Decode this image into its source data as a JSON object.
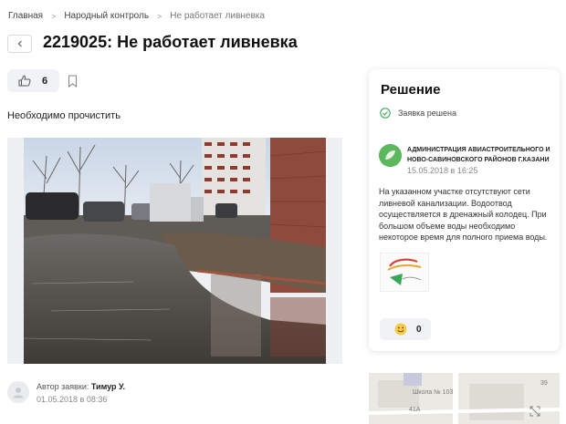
{
  "breadcrumb": [
    "Главная",
    "Народный контроль",
    "Не работает ливневка"
  ],
  "page": {
    "title": "2219025: Не работает ливневка",
    "likes": "6",
    "description": "Необходимо прочистить"
  },
  "author": {
    "label": "Автор заявки:",
    "name": "Тимур У.",
    "date": "01.05.2018 в 08:36"
  },
  "solution": {
    "title": "Решение",
    "status": "Заявка решена",
    "org_name": "АДМИНИСТРАЦИЯ АВИАСТРОИТЕЛЬНОГО И НОВО-САВИНОВСКОГО РАЙОНОВ Г.КАЗАНИ",
    "date": "15.05.2018 в 16:25",
    "text": "На указанном участке отсутствуют сети ливневой канализации. Водоотвод осуществляется в дренажный колодец. При большом объеме воды необходимо некоторое время для полного приема воды.",
    "reactions": "0"
  },
  "map": {
    "label_school": "Школа № 103",
    "label_41a": "41А",
    "label_39": "39"
  },
  "colors": {
    "accent_green": "#3aa65a",
    "button_bg": "#f1f2f5"
  }
}
